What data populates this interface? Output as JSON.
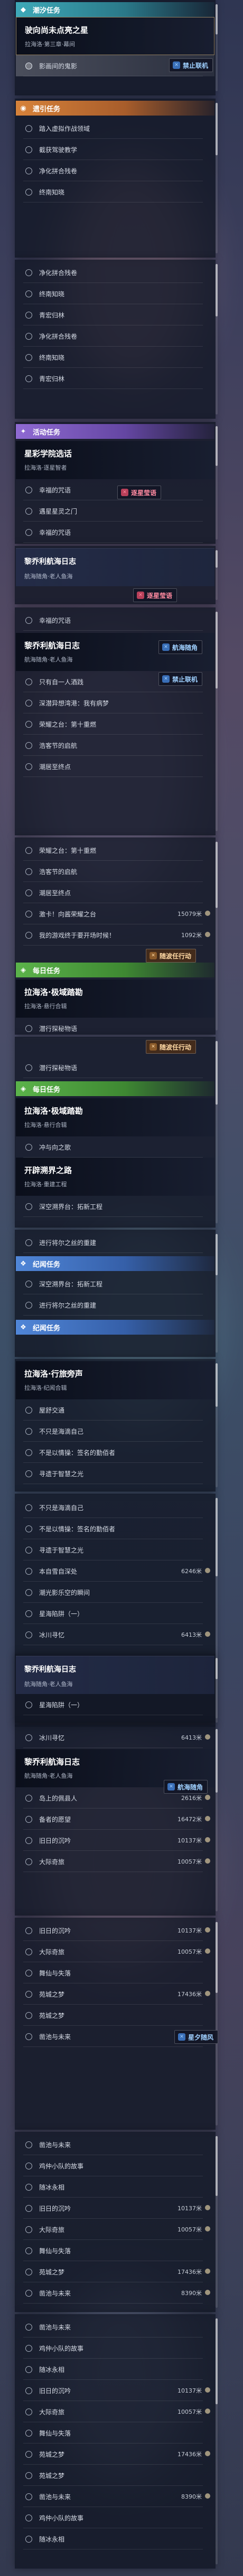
{
  "sections": {
    "ongoing": "潮汐任务",
    "legend": "遗引任务",
    "activity": "活动任务",
    "daily": "每日任务",
    "limited": "纪闻任务"
  },
  "m1": {
    "title": "驶向尚未点亮之星",
    "sub": "拉海洛·第三章·幕间"
  },
  "m2": {
    "title": "星彩学院选话",
    "sub": "拉海洛·逐星智者"
  },
  "m3": {
    "title": "黎乔利航海日志",
    "sub": "航海随角·老人鱼海"
  },
  "m4": {
    "title": "黎乔利航海日志",
    "sub": "航海随角·老人鱼海"
  },
  "m5": {
    "title": "拉海洛·极域踏勘",
    "sub": "拉海洛·悬行合辑"
  },
  "m6": {
    "title": "拉海洛·极域踏勘",
    "sub": "拉海洛·悬行合辑"
  },
  "m7": {
    "title": "开辟溯界之路",
    "sub": "拉海洛·重建工程"
  },
  "m8": {
    "title": "拉海洛·行旅旁声",
    "sub": "拉海洛·纪闻合辑"
  },
  "m9": {
    "title": "黎乔利航海日志",
    "sub": "航海随角·老人鱼海"
  },
  "m10": {
    "title": "黎乔利航海日志",
    "sub": "航海随角·老人鱼海"
  },
  "s": {
    "a1": "影画间的鬼影",
    "a2": "踏入虚拟作战领域",
    "a3": "截获驾驶教学",
    "a4": "净化拼合残卷",
    "a5": "终南知晓",
    "b1": "净化拼合残卷",
    "b2": "终南知晓",
    "b3": "青宏归林",
    "b4": "净化拼合残卷",
    "b5": "终南知晓",
    "b6": "青宏归林",
    "c1": "幸福的咒语",
    "c2": "遇星星灵之门",
    "c3": "幸福的咒语",
    "d1": "只有自一人酒践",
    "d2": "深潜异想湾港：我有病梦",
    "d3": "荣耀之台：第十重燃",
    "d4": "浩客节的启航",
    "d5": "潮居至终点",
    "e1": "荣耀之台：第十重燃",
    "e2": "浩客节的启航",
    "e3": "潮居至终点",
    "e4": "激卡！向酱荣耀之台",
    "e5": "我的游戏终于要开场时候！",
    "f1": "潜行探秘物语",
    "g1": "冲与向之歌",
    "g2": "深空溯界台：拓新工程",
    "g3": "进行将尔之丝的重建",
    "g4": "深空溯界台：拓新工程",
    "g5": "进行将尔之丝的重建",
    "h1": "屋舒交通",
    "h2": "不只是海滴自己",
    "h3": "不是以情操：签名的勤佰者",
    "h4": "寻遗于智慧之光",
    "i1": "不只是海滴自己",
    "i2": "不是以情操：签名的勤佰者",
    "i3": "寻遗于智慧之光",
    "i4": "本自雪自深处",
    "i5": "潮光影乐空的瞬间",
    "i6": "星海陷阱（一）",
    "i7": "冰川寻忆",
    "j1": "星海陷阱（一）",
    "j2": "冰川寻忆",
    "k1": "岛上的佩县人",
    "k2": "备者的愿望",
    "k3": "旧日的沉吟",
    "k4": "大际奇旅",
    "l1": "旧日的沉吟",
    "l2": "大际奇旅",
    "l3": "舞仙与失落",
    "l4": "苑城之梦",
    "l5": "苑城之梦",
    "l6": "凿池与未来",
    "m1": "凿池与未来",
    "m2": "鸡仲小队的故事",
    "m3": "随冰永相"
  },
  "counts": {
    "c1": "15079",
    "c2": "1092",
    "c3": "6246",
    "c4": "6413",
    "c5": "6413",
    "c6": "2616",
    "c7": "16472",
    "c8": "10137",
    "c9": "10057",
    "c10": "10137",
    "c11": "10057",
    "c12": "17436",
    "c13": "8390"
  },
  "unit": "米",
  "tags": {
    "ban": "禁止联机",
    "star": "逐星莹语",
    "nav": "航海随角",
    "story": "随波任行动",
    "ship": "星夕随风"
  },
  "hint": "新任务接受"
}
